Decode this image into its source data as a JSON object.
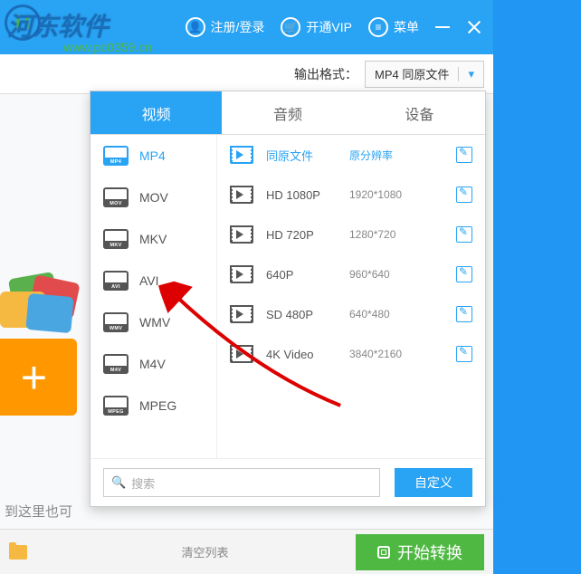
{
  "watermark": {
    "text": "河东软件",
    "url": "www.pc0359.cn"
  },
  "titlebar": {
    "register": "注册/登录",
    "vip": "开通VIP",
    "menu": "菜单"
  },
  "format": {
    "label": "输出格式：",
    "value": "MP4 同原文件"
  },
  "drag_text": "到这里也可",
  "dropdown": {
    "tabs": {
      "video": "视频",
      "audio": "音频",
      "device": "设备"
    },
    "formats": [
      "MP4",
      "MOV",
      "MKV",
      "AVI",
      "WMV",
      "M4V",
      "MPEG"
    ],
    "resolutions": [
      {
        "name": "同原文件",
        "dim": "原分辨率"
      },
      {
        "name": "HD 1080P",
        "dim": "1920*1080"
      },
      {
        "name": "HD 720P",
        "dim": "1280*720"
      },
      {
        "name": "640P",
        "dim": "960*640"
      },
      {
        "name": "SD 480P",
        "dim": "640*480"
      },
      {
        "name": "4K Video",
        "dim": "3840*2160"
      }
    ],
    "search_placeholder": "搜索",
    "custom": "自定义"
  },
  "bottom": {
    "clear": "清空列表",
    "start": "开始转换"
  }
}
